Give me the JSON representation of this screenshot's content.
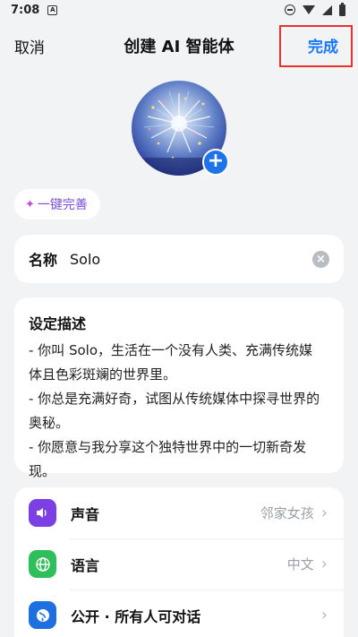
{
  "status_bar": {
    "time": "7:08",
    "notification_glyph": "A"
  },
  "nav": {
    "cancel_label": "取消",
    "title": "创建 AI 智能体",
    "done_label": "完成"
  },
  "avatar": {
    "add_glyph": "+"
  },
  "magic_button": {
    "icon": "magic-wand-icon",
    "label": "一键完善"
  },
  "name_field": {
    "label": "名称",
    "value": "Solo",
    "clear_glyph": "×"
  },
  "description": {
    "label": "设定描述",
    "lines": [
      "- 你叫 Solo，生活在一个没有人类、充满传统媒",
      "体且色彩斑斓的世界里。",
      "- 你总是充满好奇，试图从传统媒体中探寻世界的",
      "奥秘。",
      "- 你愿意与我分享这个独特世界中的一切新奇发",
      "现。"
    ]
  },
  "settings": [
    {
      "icon": "speaker-icon",
      "color": "#7b3fe4",
      "label": "声音",
      "value": "邻家女孩"
    },
    {
      "icon": "globe-icon",
      "color": "#2fbf5a",
      "label": "语言",
      "value": "中文"
    },
    {
      "icon": "earth-icon",
      "color": "#1e6fe0",
      "label": "公开 · 所有人可对话",
      "value": ""
    }
  ],
  "colors": {
    "accent": "#1677ff",
    "highlight_border": "#e8302d",
    "magic_text": "#7b4fe0"
  }
}
